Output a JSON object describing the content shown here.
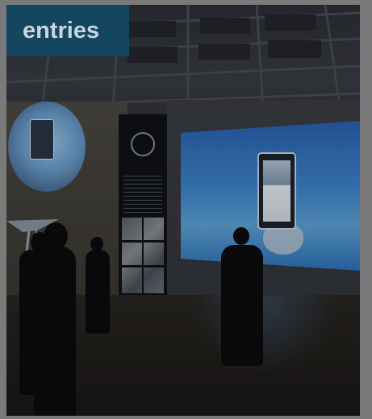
{
  "card": {
    "label": "entries",
    "label_color": "#15465f"
  }
}
